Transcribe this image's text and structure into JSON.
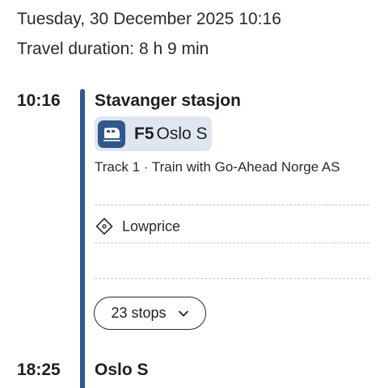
{
  "header": {
    "date_time": "Tuesday, 30 December 2025 10:16",
    "travel_duration": "Travel duration: 8 h 9 min"
  },
  "departure": {
    "time": "10:16",
    "station": "Stavanger stasjon",
    "line": {
      "code": "F5",
      "destination": "Oslo S",
      "icon": "train-icon"
    },
    "track_info": "Track 1 · Train with Go-Ahead Norge AS",
    "ticket": {
      "icon": "ticket-icon",
      "label": "Lowprice"
    },
    "stops_button": {
      "label": "23 stops",
      "icon": "chevron-down-icon"
    }
  },
  "arrival": {
    "time": "18:25",
    "station": "Oslo S"
  },
  "colors": {
    "accent": "#30588f",
    "chip_background": "#dfe6f0"
  }
}
